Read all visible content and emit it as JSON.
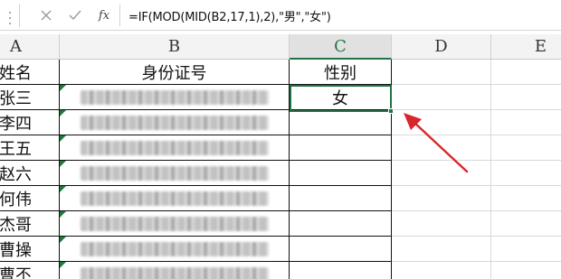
{
  "formula_bar": {
    "cancel_icon": "close-icon",
    "enter_icon": "check-icon",
    "fx_label": "fx",
    "formula": "=IF(MOD(MID(B2,17,1),2),\"男\",\"女\")"
  },
  "columns": [
    {
      "label": "A",
      "selected": false
    },
    {
      "label": "B",
      "selected": false
    },
    {
      "label": "C",
      "selected": true
    },
    {
      "label": "D",
      "selected": false
    },
    {
      "label": "E",
      "selected": false
    }
  ],
  "header_row": {
    "a": "姓名",
    "b": "身份证号",
    "c": "性别"
  },
  "rows": [
    {
      "a": "张三",
      "c": "女"
    },
    {
      "a": "李四",
      "c": ""
    },
    {
      "a": "王五",
      "c": ""
    },
    {
      "a": "赵六",
      "c": ""
    },
    {
      "a": "何伟",
      "c": ""
    },
    {
      "a": "杰哥",
      "c": ""
    },
    {
      "a": "曹操",
      "c": ""
    },
    {
      "a": "曹丕",
      "c": ""
    }
  ],
  "colors": {
    "accent": "#217346",
    "arrow": "#d9262b",
    "error_indicator": "#1e7a3c"
  },
  "annotation": {
    "icon": "red-arrow-icon"
  }
}
